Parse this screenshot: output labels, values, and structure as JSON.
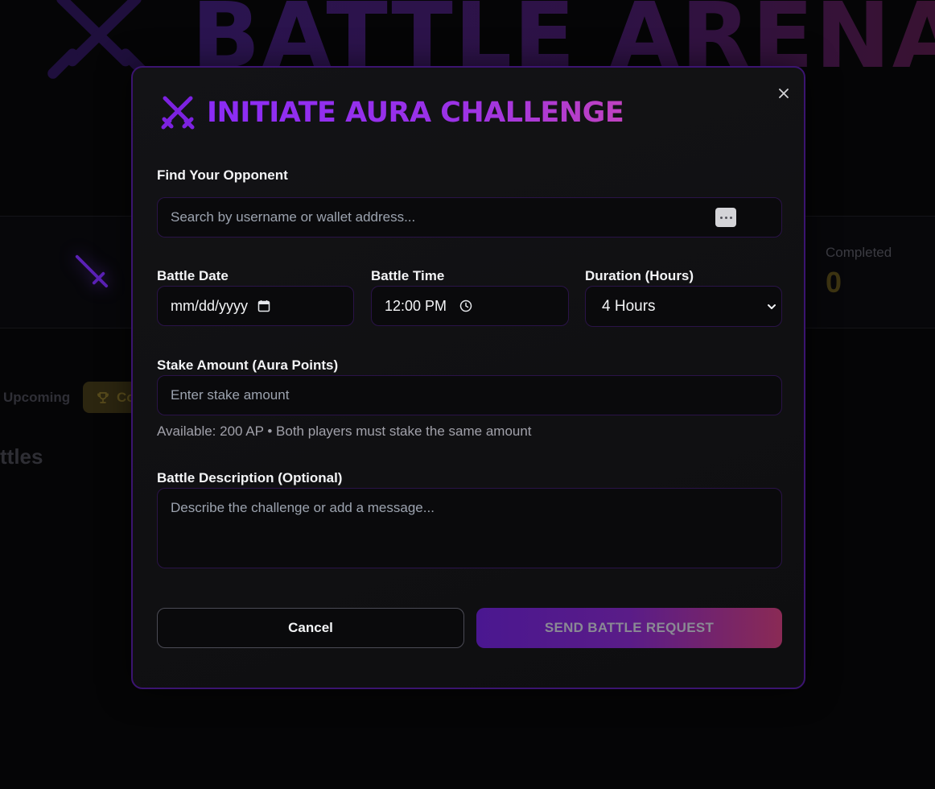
{
  "background": {
    "title": "BATTLE ARENA",
    "completed_label": "Completed",
    "completed_value": "0",
    "tab_upcoming": "Upcoming",
    "tab_completed_partial": "Co",
    "section_heading_partial": "ttles"
  },
  "modal": {
    "title": "INITIATE AURA CHALLENGE",
    "opponent": {
      "label": "Find Your Opponent",
      "placeholder": "Search by username or wallet address..."
    },
    "date": {
      "label": "Battle Date",
      "value": "mm/dd/yyyy"
    },
    "time": {
      "label": "Battle Time",
      "value": "12:00 PM"
    },
    "duration": {
      "label": "Duration (Hours)",
      "selected": "4 Hours"
    },
    "stake": {
      "label": "Stake Amount (Aura Points)",
      "placeholder": "Enter stake amount",
      "helper": "Available: 200 AP • Both players must stake the same amount"
    },
    "description": {
      "label": "Battle Description (Optional)",
      "placeholder": "Describe the challenge or add a message..."
    },
    "cancel_label": "Cancel",
    "send_label": "SEND BATTLE REQUEST"
  },
  "colors": {
    "accent_purple": "#8b2cf5",
    "accent_pink": "#c042c0",
    "border_purple": "#3b1470",
    "send_gradient_start": "#4a1790",
    "send_gradient_end": "#8a2a55"
  }
}
